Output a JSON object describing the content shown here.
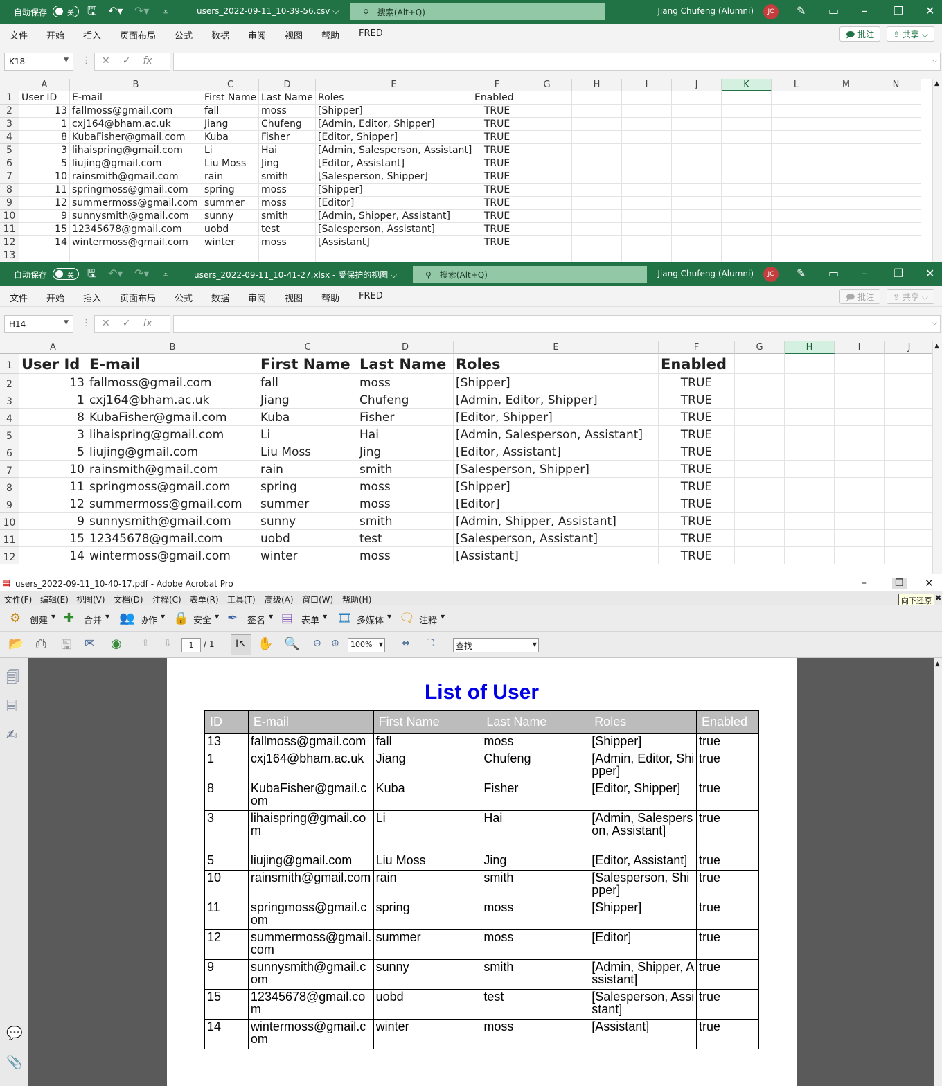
{
  "excel_csv": {
    "autosave_label": "自动保存",
    "autosave_state": "关",
    "filename": "users_2022-09-11_10-39-56.csv",
    "search_text": "搜索(Alt+Q)",
    "user": "Jiang Chufeng (Alumni)",
    "avatar": "JC",
    "menu": [
      "文件",
      "开始",
      "插入",
      "页面布局",
      "公式",
      "数据",
      "审阅",
      "视图",
      "帮助",
      "FRED"
    ],
    "comments_label": "批注",
    "share_label": "共享",
    "name_box": "K18",
    "fx": "fx",
    "columns": [
      "A",
      "B",
      "C",
      "D",
      "E",
      "F",
      "G",
      "H",
      "I",
      "J",
      "K",
      "L",
      "M",
      "N"
    ],
    "selected_column": "K",
    "row_numbers": [
      "1",
      "2",
      "3",
      "4",
      "5",
      "6",
      "7",
      "8",
      "9",
      "10",
      "11",
      "12",
      "13"
    ],
    "header": [
      "User ID",
      "E-mail",
      "First Name",
      "Last Name",
      "Roles",
      "Enabled"
    ],
    "rows": [
      [
        "13",
        "fallmoss@gmail.com",
        "fall",
        "moss",
        "[Shipper]",
        "TRUE"
      ],
      [
        "1",
        "cxj164@bham.ac.uk",
        "Jiang",
        "Chufeng",
        "[Admin, Editor, Shipper]",
        "TRUE"
      ],
      [
        "8",
        "KubaFisher@gmail.com",
        "Kuba",
        "Fisher",
        "[Editor, Shipper]",
        "TRUE"
      ],
      [
        "3",
        "lihaispring@gmail.com",
        "Li",
        "Hai",
        "[Admin, Salesperson, Assistant]",
        "TRUE"
      ],
      [
        "5",
        "liujing@gmail.com",
        "Liu Moss",
        "Jing",
        "[Editor, Assistant]",
        "TRUE"
      ],
      [
        "10",
        "rainsmith@gmail.com",
        "rain",
        "smith",
        "[Salesperson, Shipper]",
        "TRUE"
      ],
      [
        "11",
        "springmoss@gmail.com",
        "spring",
        "moss",
        "[Shipper]",
        "TRUE"
      ],
      [
        "12",
        "summermoss@gmail.com",
        "summer",
        "moss",
        "[Editor]",
        "TRUE"
      ],
      [
        "9",
        "sunnysmith@gmail.com",
        "sunny",
        "smith",
        "[Admin, Shipper, Assistant]",
        "TRUE"
      ],
      [
        "15",
        "12345678@gmail.com",
        "uobd",
        "test",
        "[Salesperson, Assistant]",
        "TRUE"
      ],
      [
        "14",
        "wintermoss@gmail.com",
        "winter",
        "moss",
        "[Assistant]",
        "TRUE"
      ]
    ]
  },
  "excel_xlsx": {
    "autosave_label": "自动保存",
    "autosave_state": "关",
    "filename": "users_2022-09-11_10-41-27.xlsx  -  受保护的视图",
    "search_text": "搜索(Alt+Q)",
    "user": "Jiang Chufeng (Alumni)",
    "avatar": "JC",
    "menu": [
      "文件",
      "开始",
      "插入",
      "页面布局",
      "公式",
      "数据",
      "审阅",
      "视图",
      "帮助",
      "FRED"
    ],
    "comments_label": "批注",
    "share_label": "共享",
    "name_box": "H14",
    "fx": "fx",
    "columns": [
      "A",
      "B",
      "C",
      "D",
      "E",
      "F",
      "G",
      "H",
      "I",
      "J"
    ],
    "selected_column": "H",
    "row_numbers": [
      "1",
      "2",
      "3",
      "4",
      "5",
      "6",
      "7",
      "8",
      "9",
      "10",
      "11",
      "12"
    ],
    "header": [
      "User Id",
      "E-mail",
      "First Name",
      "Last Name",
      "Roles",
      "Enabled"
    ]
  },
  "acrobat": {
    "title": "users_2022-09-11_10-40-17.pdf - Adobe Acrobat Pro",
    "menu": [
      "文件(F)",
      "编辑(E)",
      "视图(V)",
      "文档(D)",
      "注释(C)",
      "表单(R)",
      "工具(T)",
      "高级(A)",
      "窗口(W)",
      "帮助(H)"
    ],
    "tooltip": "向下还原",
    "toolbar1": [
      "创建",
      "合并",
      "协作",
      "安全",
      "签名",
      "表单",
      "多媒体",
      "注释"
    ],
    "page_current": "1",
    "page_total": "/ 1",
    "zoom": "100%",
    "find_placeholder": "查找",
    "doc_title": "List of User",
    "table_header": [
      "ID",
      "E-mail",
      "First Name",
      "Last Name",
      "Roles",
      "Enabled"
    ],
    "table_rows": [
      [
        "13",
        "fallmoss@gmail.com",
        "fall",
        "moss",
        "[Shipper]",
        "true"
      ],
      [
        "1",
        "cxj164@bham.ac.uk",
        "Jiang",
        "Chufeng",
        "[Admin, Editor, Shipper]",
        "true"
      ],
      [
        "8",
        "KubaFisher@gmail.com",
        "Kuba",
        "Fisher",
        "[Editor, Shipper]",
        "true"
      ],
      [
        "3",
        "lihaispring@gmail.com",
        "Li",
        "Hai",
        "[Admin, Salesperson, Assistant]",
        "true"
      ],
      [
        "5",
        "liujing@gmail.com",
        "Liu Moss",
        "Jing",
        "[Editor, Assistant]",
        "true"
      ],
      [
        "10",
        "rainsmith@gmail.com",
        "rain",
        "smith",
        "[Salesperson, Shipper]",
        "true"
      ],
      [
        "11",
        "springmoss@gmail.com",
        "spring",
        "moss",
        "[Shipper]",
        "true"
      ],
      [
        "12",
        "summermoss@gmail.com",
        "summer",
        "moss",
        "[Editor]",
        "true"
      ],
      [
        "9",
        "sunnysmith@gmail.com",
        "sunny",
        "smith",
        "[Admin, Shipper, Assistant]",
        "true"
      ],
      [
        "15",
        "12345678@gmail.com",
        "uobd",
        "test",
        "[Salesperson, Assistant]",
        "true"
      ],
      [
        "14",
        "wintermoss@gmail.com",
        "winter",
        "moss",
        "[Assistant]",
        "true"
      ]
    ]
  }
}
